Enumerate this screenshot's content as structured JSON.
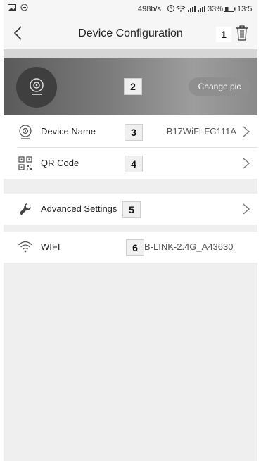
{
  "status_bar": {
    "network_speed": "498b/s",
    "battery": "33%",
    "time": "13:55"
  },
  "nav": {
    "title": "Device Configuration"
  },
  "banner": {
    "change_pic_label": "Change pic"
  },
  "annotations": [
    "1",
    "2",
    "3",
    "4",
    "5",
    "6"
  ],
  "rows": {
    "device_name": {
      "label": "Device Name",
      "value": "B17WiFi-FC111A",
      "icon": "camera-icon"
    },
    "qr_code": {
      "label": "QR Code",
      "icon": "qr-code-icon"
    },
    "advanced": {
      "label": "Advanced Settings",
      "icon": "wrench-icon"
    },
    "wifi": {
      "label": "WIFI",
      "value": "B-LINK-2.4G_A43630",
      "icon": "wifi-icon"
    }
  },
  "colors": {
    "background": "#efefef",
    "banner_gradient_start": "#5a5a5a",
    "banner_gradient_end": "#9d9d9d",
    "row_background": "#ffffff"
  }
}
